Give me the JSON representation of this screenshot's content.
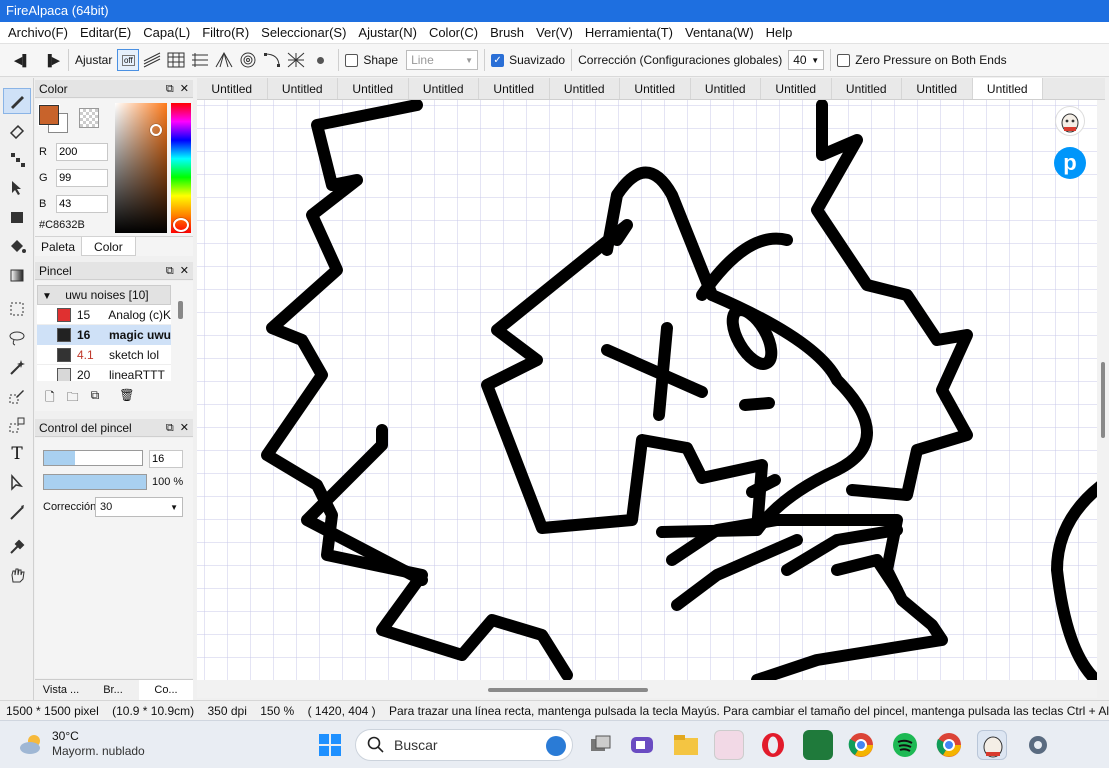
{
  "window": {
    "title": "FireAlpaca (64bit)"
  },
  "menu": [
    "Archivo(F)",
    "Editar(E)",
    "Capa(L)",
    "Filtro(R)",
    "Seleccionar(S)",
    "Ajustar(N)",
    "Color(C)",
    "Brush",
    "Ver(V)",
    "Herramienta(T)",
    "Ventana(W)",
    "Help"
  ],
  "toolbar": {
    "ajustar_label": "Ajustar",
    "snap_off_label": "off",
    "shape_label": "Shape",
    "shape_value": "Line",
    "suavizado_label": "Suavizado",
    "suavizado_checked": true,
    "correccion_label": "Corrección (Configuraciones globales)",
    "correccion_value": "40",
    "zero_pressure_label": "Zero Pressure on Both Ends"
  },
  "color_panel": {
    "title": "Color",
    "r_label": "R",
    "r_value": "200",
    "g_label": "G",
    "g_value": "99",
    "b_label": "B",
    "b_value": "43",
    "hex": "#C8632B",
    "tab_palette": "Paleta",
    "tab_color": "Color",
    "current_color": "#c8632b"
  },
  "brush_panel": {
    "title": "Pincel",
    "group": "uwu noises [10]",
    "items": [
      {
        "size": "15",
        "name": "Analog (c)K",
        "swatch": "#e03030"
      },
      {
        "size": "16",
        "name": "magic uwu",
        "swatch": "#222222"
      },
      {
        "size": "4.1",
        "name": "sketch lol",
        "swatch": "#333333"
      },
      {
        "size": "20",
        "name": "lineaRTTT",
        "swatch": "#d8d8d8"
      }
    ]
  },
  "brush_control": {
    "title": "Control del pincel",
    "size_value": "16",
    "size_fraction": 0.32,
    "opacity_value": "100 %",
    "opacity_fraction": 1.0,
    "correccion_label": "Corrección",
    "correccion_value": "30"
  },
  "bottom_tabs": [
    "Vista ...",
    "Br...",
    "Co..."
  ],
  "tabs": [
    "Untitled",
    "Untitled",
    "Untitled",
    "Untitled",
    "Untitled",
    "Untitled",
    "Untitled",
    "Untitled",
    "Untitled",
    "Untitled",
    "Untitled",
    "Untitled"
  ],
  "status": {
    "size": "1500 * 1500 pixel",
    "cm": "(10.9 * 10.9cm)",
    "dpi": "350 dpi",
    "zoom": "150 %",
    "coords": "( 1420, 404 )",
    "hint": "Para trazar una línea recta, mantenga pulsada la tecla Mayús. Para cambiar el tamaño del pincel, mantenga pulsada las teclas Ctrl + Alt y arrastre"
  },
  "taskbar": {
    "weather_temp": "30°C",
    "weather_desc": "Mayorm. nublado",
    "search_label": "Buscar"
  }
}
